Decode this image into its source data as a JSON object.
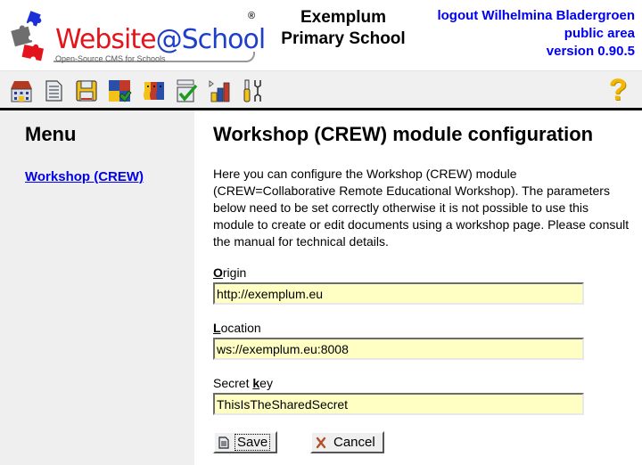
{
  "header": {
    "logo": {
      "wordmark_part1": "Website",
      "wordmark_part2": "@School",
      "registered": "®",
      "tagline": "Open-Source CMS for Schools"
    },
    "school_name_line1": "Exemplum",
    "school_name_line2": "Primary School",
    "logout_label": "logout Wilhelmina Bladergroen",
    "area_label": "public area",
    "version_label": "version 0.90.5"
  },
  "toolbar": {
    "icons": [
      "start-center-icon",
      "page-manager-icon",
      "file-manager-icon",
      "modules-icon",
      "account-manager-icon",
      "configuration-manager-icon",
      "statistics-icon",
      "tools-icon"
    ],
    "help_glyph": "?"
  },
  "sidebar": {
    "title": "Menu",
    "items": [
      {
        "label": "Workshop (CREW)"
      }
    ]
  },
  "main": {
    "title": "Workshop (CREW) module configuration",
    "intro": "Here you can configure the Workshop (CREW) module (CREW=Collaborative Remote Educational Workshop). The parameters below need to be set correctly otherwise it is not possible to use this module to create or edit documents using a workshop page. Please consult the manual for technical details.",
    "fields": [
      {
        "label_prefix": "",
        "label_key": "O",
        "label_rest": "rigin",
        "value": "http://exemplum.eu"
      },
      {
        "label_prefix": "",
        "label_key": "L",
        "label_rest": "ocation",
        "value": "ws://exemplum.eu:8008"
      },
      {
        "label_prefix": "Secret ",
        "label_key": "k",
        "label_rest": "ey",
        "value": "ThisIsTheSharedSecret"
      }
    ],
    "save_label": "Save",
    "cancel_label": "Cancel"
  }
}
